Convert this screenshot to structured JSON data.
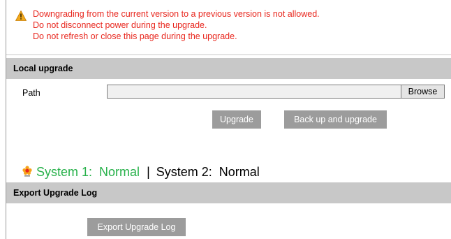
{
  "warnings": [
    "Downgrading from the current version to a previous version is not allowed.",
    "Do not disconnect power during the upgrade.",
    "Do not refresh or close this page during the upgrade."
  ],
  "warning_icon": "warning-triangle-icon",
  "local_upgrade": {
    "header": "Local upgrade",
    "path_label": "Path",
    "path_value": "",
    "browse_label": "Browse",
    "upgrade_label": "Upgrade",
    "backup_upgrade_label": "Back up and upgrade"
  },
  "system_status": {
    "icon": "status-flower-icon",
    "system1_label": "System 1:",
    "system1_value": "Normal",
    "separator": "|",
    "system2_label": "System 2:",
    "system2_value": "Normal",
    "ok_color": "#27b14a"
  },
  "export_log": {
    "header": "Export Upgrade Log",
    "button_label": "Export Upgrade Log"
  },
  "colors": {
    "warning_text": "#e8261d",
    "section_header_bg": "#c8c8c8",
    "button_bg": "#9c9c9c"
  }
}
